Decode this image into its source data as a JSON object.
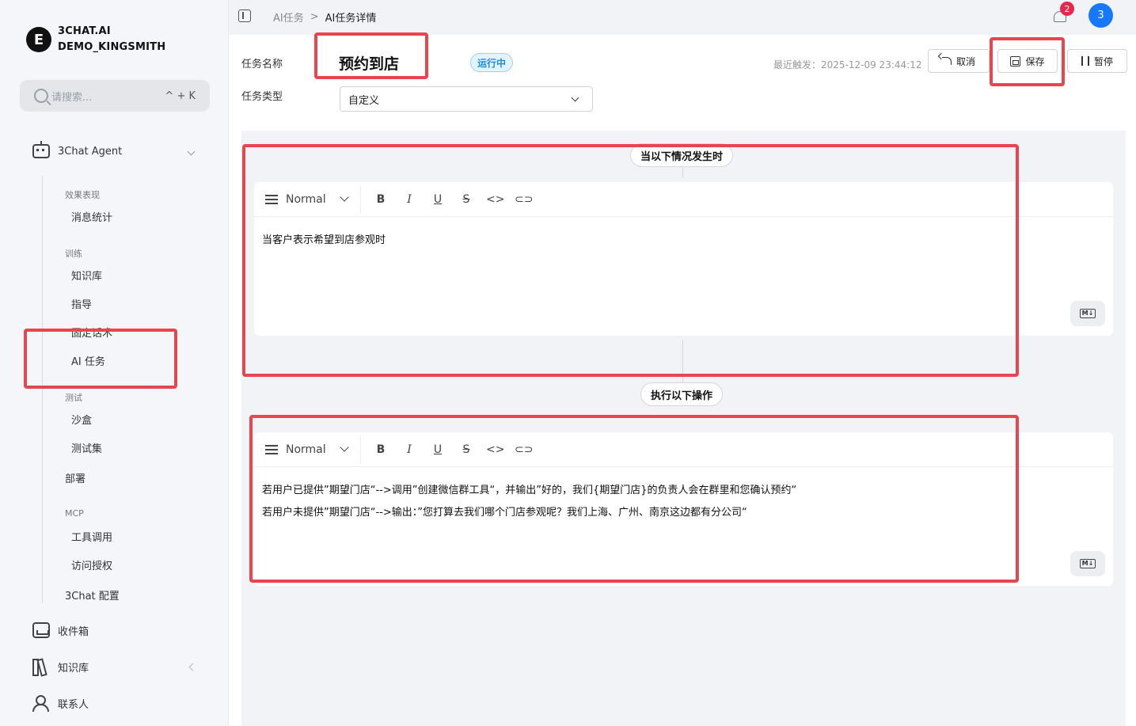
{
  "brand": {
    "line1": "3CHAT.AI",
    "line2": "DEMO_KINGSMITH",
    "logo": "E"
  },
  "search": {
    "placeholder": "请搜索...",
    "shortcut": "^ + K"
  },
  "sidebar": {
    "agent": "3Chat Agent",
    "groups": [
      {
        "label": "效果表现",
        "items": [
          "消息统计"
        ]
      },
      {
        "label": "训练",
        "items": [
          "知识库",
          "指导",
          "固定话术",
          "AI 任务"
        ]
      },
      {
        "label": "测试",
        "items": [
          "沙盒",
          "测试集"
        ]
      },
      {
        "label": "",
        "items": [
          "部署"
        ]
      },
      {
        "label": "MCP",
        "items": [
          "工具调用",
          "访问授权"
        ]
      },
      {
        "label": "",
        "items": [
          "3Chat 配置"
        ]
      }
    ],
    "bottom": [
      "收件箱",
      "知识库",
      "联系人"
    ]
  },
  "breadcrumb": {
    "parent": "AI任务",
    "sep": ">",
    "current": "AI任务详情"
  },
  "notifications": {
    "count": "2"
  },
  "user": {
    "avatar": "3"
  },
  "task": {
    "name_label": "任务名称",
    "name": "预约到店",
    "status": "运行中",
    "last_run": "最近触发：2025-12-09 23:44:12",
    "type_label": "任务类型",
    "type_value": "自定义"
  },
  "actions": {
    "cancel": "取消",
    "save": "保存",
    "pause": "暂停"
  },
  "trigger": {
    "pill": "当以下情况发生时",
    "paragraph_style": "Normal",
    "text": "当客户表示希望到店参观时"
  },
  "action": {
    "pill": "执行以下操作",
    "paragraph_style": "Normal",
    "line1": "若用户已提供”期望门店“-->调用”创建微信群工具“，并输出”好的，我们{期望门店}的负责人会在群里和您确认预约“",
    "line2": "若用户未提供”期望门店“-->输出：”您打算去我们哪个门店参观呢？我们上海、广州、南京这边都有分公司“"
  },
  "toolbar": {
    "bold": "B",
    "italic": "I",
    "underline": "U",
    "strike": "S",
    "code": "<>",
    "link": "⊂⊃",
    "markdown": "M↓"
  }
}
